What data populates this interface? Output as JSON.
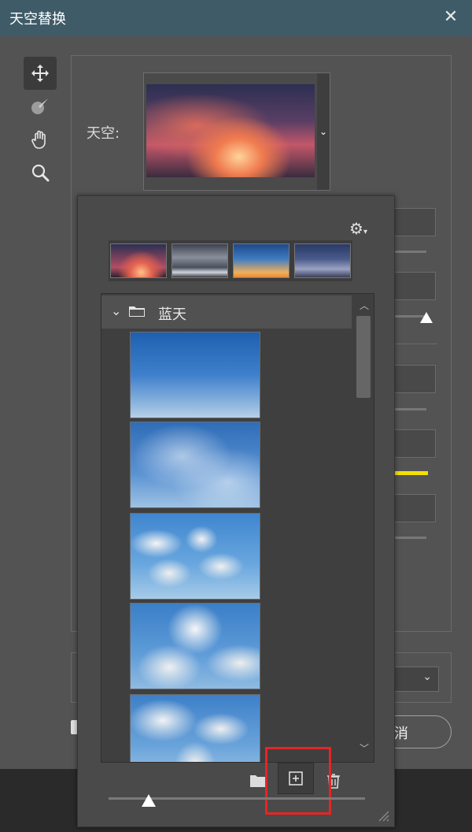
{
  "window": {
    "title": "天空替换",
    "close_icon": "close-icon"
  },
  "tools": [
    {
      "name": "move-tool",
      "icon": "move-icon",
      "active": true
    },
    {
      "name": "sky-brush-tool",
      "icon": "brush-icon"
    },
    {
      "name": "hand-tool",
      "icon": "hand-icon"
    },
    {
      "name": "zoom-tool",
      "icon": "magnifier-icon"
    }
  ],
  "sky": {
    "label": "天空:"
  },
  "popup": {
    "settings_icon": "gear-icon",
    "recent_thumbnails": [
      "sunset-sky",
      "stormy-clouds",
      "blue-orange-dusk",
      "twilight-sky"
    ],
    "folder": {
      "name": "蓝天",
      "expanded": true
    },
    "thumbnails": [
      "clear-blue-sky",
      "wispy-clouds",
      "scattered-cumulus",
      "fluffy-clouds",
      "cloudy-blue-sky"
    ],
    "buttons": {
      "new_group": "folder-icon",
      "add_sky": "plus-square-icon",
      "delete": "trash-icon"
    },
    "thumbnail_size_level": 0.15
  },
  "footer": {
    "cancel_label": "消"
  },
  "colors": {
    "title_bar": "#3f5b68",
    "dialog_bg": "#535353",
    "popup_bg": "#4a4a4a",
    "highlight_box": "#e82424",
    "yellow_bar": "#f0e000"
  }
}
